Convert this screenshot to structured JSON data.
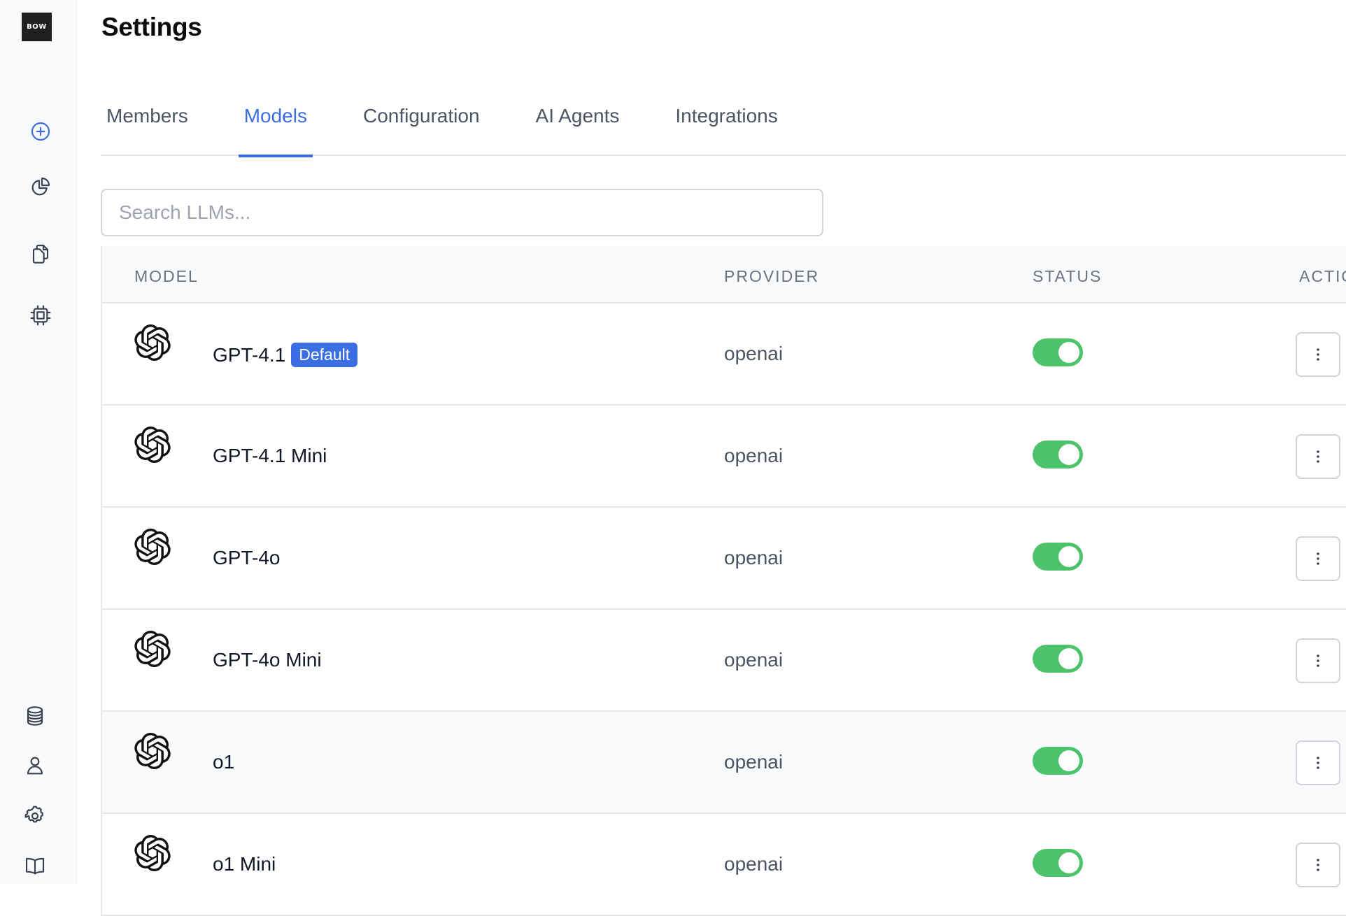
{
  "sidebar": {
    "logo_text": "BOW",
    "top_icons": [
      "plus-circle-icon",
      "chart-pie-icon",
      "documents-icon",
      "cpu-icon"
    ],
    "bottom_icons": [
      "database-icon",
      "user-icon",
      "gear-icon",
      "book-icon"
    ]
  },
  "header": {
    "title": "Settings"
  },
  "tabs": [
    {
      "label": "Members",
      "active": false
    },
    {
      "label": "Models",
      "active": true
    },
    {
      "label": "Configuration",
      "active": false
    },
    {
      "label": "AI Agents",
      "active": false
    },
    {
      "label": "Integrations",
      "active": false
    }
  ],
  "search": {
    "placeholder": "Search LLMs...",
    "value": ""
  },
  "table": {
    "columns": {
      "model": "MODEL",
      "provider": "PROVIDER",
      "status": "STATUS",
      "actions": "ACTIO"
    },
    "rows": [
      {
        "name": "GPT-4.1",
        "badge": "Default",
        "provider": "openai",
        "enabled": true,
        "icon": "openai-icon"
      },
      {
        "name": "GPT-4.1 Mini",
        "provider": "openai",
        "enabled": true,
        "icon": "openai-icon"
      },
      {
        "name": "GPT-4o",
        "provider": "openai",
        "enabled": true,
        "icon": "openai-icon"
      },
      {
        "name": "GPT-4o Mini",
        "provider": "openai",
        "enabled": true,
        "icon": "openai-icon"
      },
      {
        "name": "o1",
        "provider": "openai",
        "enabled": true,
        "icon": "openai-icon"
      },
      {
        "name": "o1 Mini",
        "provider": "openai",
        "enabled": true,
        "icon": "openai-icon"
      }
    ]
  },
  "colors": {
    "accent": "#3b6ee3",
    "toggle_on": "#4cc36a",
    "border": "#e5e7eb"
  }
}
